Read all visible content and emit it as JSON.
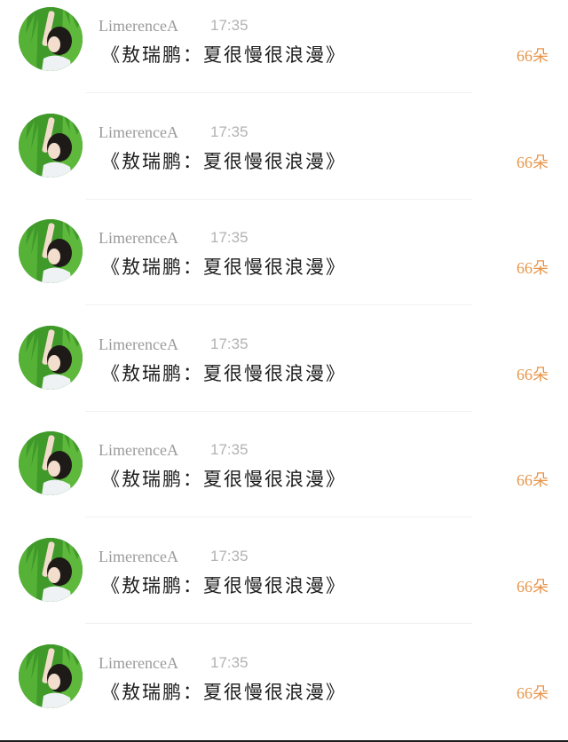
{
  "feed": {
    "items": [
      {
        "username": "LimerenceA",
        "time": "17:35",
        "message": "《敖瑞鹏：夏很慢很浪漫》",
        "amount": "66朵"
      },
      {
        "username": "LimerenceA",
        "time": "17:35",
        "message": "《敖瑞鹏：夏很慢很浪漫》",
        "amount": "66朵"
      },
      {
        "username": "LimerenceA",
        "time": "17:35",
        "message": "《敖瑞鹏：夏很慢很浪漫》",
        "amount": "66朵"
      },
      {
        "username": "LimerenceA",
        "time": "17:35",
        "message": "《敖瑞鹏：夏很慢很浪漫》",
        "amount": "66朵"
      },
      {
        "username": "LimerenceA",
        "time": "17:35",
        "message": "《敖瑞鹏：夏很慢很浪漫》",
        "amount": "66朵"
      },
      {
        "username": "LimerenceA",
        "time": "17:35",
        "message": "《敖瑞鹏：夏很慢很浪漫》",
        "amount": "66朵"
      },
      {
        "username": "LimerenceA",
        "time": "17:35",
        "message": "《敖瑞鹏：夏很慢很浪漫》",
        "amount": "66朵"
      }
    ]
  },
  "colors": {
    "username": "#9b9b9b",
    "time": "#b2b2b2",
    "message": "#1c1c1c",
    "amount": "#e8954a",
    "avatar_grass": "#3f9a2a"
  },
  "icons": {
    "avatar": "user-avatar-photo"
  }
}
